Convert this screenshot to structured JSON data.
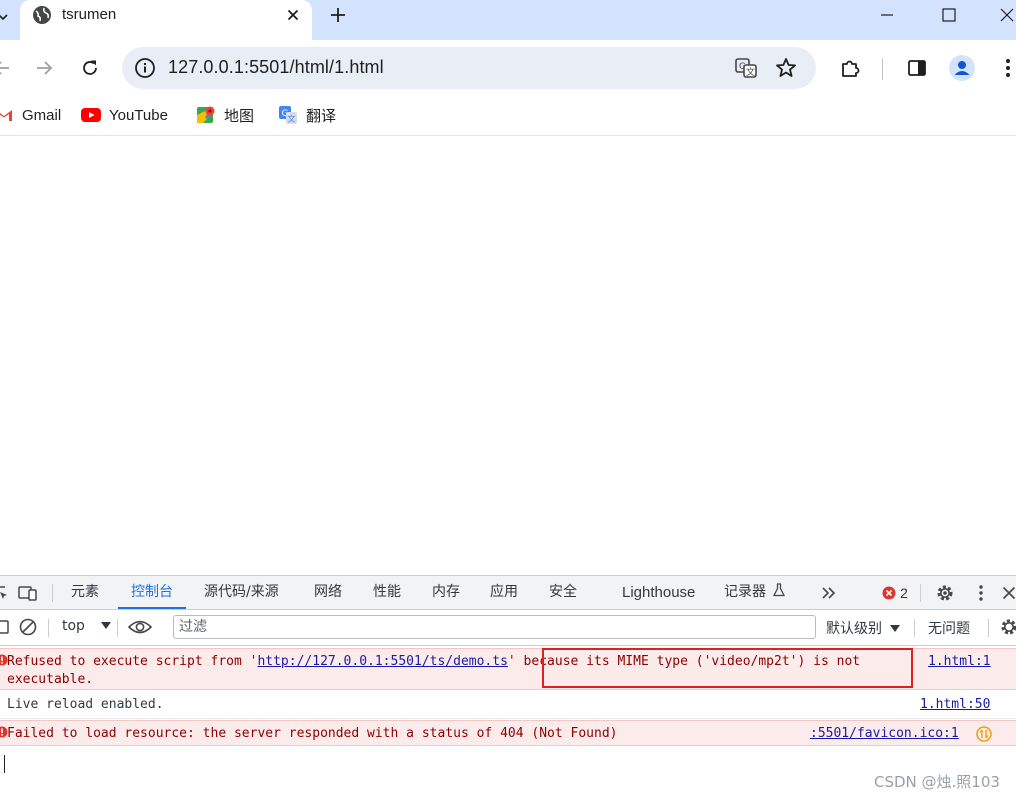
{
  "browser": {
    "tab": {
      "title": "tsrumen"
    },
    "omnibox": {
      "url": "127.0.0.1:5501/html/1.html"
    },
    "bookmarks": [
      {
        "label": "Gmail",
        "icon": "gmail-icon"
      },
      {
        "label": "YouTube",
        "icon": "youtube-icon"
      },
      {
        "label": "地图",
        "icon": "maps-icon"
      },
      {
        "label": "翻译",
        "icon": "translate-icon"
      }
    ]
  },
  "devtools": {
    "tabs": [
      {
        "label": "元素"
      },
      {
        "label": "控制台",
        "active": true
      },
      {
        "label": "源代码/来源"
      },
      {
        "label": "网络"
      },
      {
        "label": "性能"
      },
      {
        "label": "内存"
      },
      {
        "label": "应用"
      },
      {
        "label": "安全"
      },
      {
        "label": "Lighthouse"
      },
      {
        "label": "记录器"
      }
    ],
    "error_count": "2",
    "filterbar": {
      "context": "top",
      "filter_placeholder": "过滤",
      "level": "默认级别",
      "issues": "无问题"
    },
    "console": {
      "messages": [
        {
          "level": "error",
          "text_before": "Refused to execute script from '",
          "link": "http://127.0.0.1:5501/ts/demo.ts",
          "text_after": "' because its MIME type ('video/mp2t') is not",
          "text_wrap": "executable.",
          "source": "1.html:1"
        },
        {
          "level": "info",
          "text": "Live reload enabled.",
          "source": "1.html:50"
        },
        {
          "level": "error",
          "text": "Failed to load resource: the server responded with a status of 404 (Not Found)",
          "source": ":5501/favicon.ico:1"
        }
      ]
    }
  },
  "watermark": "CSDN @烛.照103",
  "colors": {
    "tabstrip": "#d3e3fd",
    "omnibox": "#e9eef6",
    "accent": "#1a73e8",
    "error_bg": "#fcebeb",
    "error_text": "#8e0000",
    "highlight": "#e02020"
  }
}
